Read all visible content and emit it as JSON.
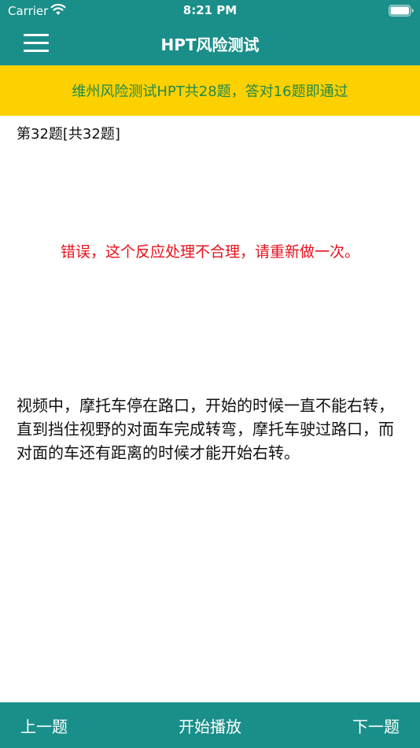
{
  "status_bar": {
    "carrier": "Carrier",
    "time": "8:21 PM"
  },
  "nav": {
    "title": "HPT风险测试"
  },
  "banner": {
    "text": "维州风险测试HPT共28题，答对16题即通过"
  },
  "question": {
    "counter": "第32题[共32题]",
    "result_message": "错误，这个反应处理不合理，请重新做一次。",
    "explanation": "视频中，摩托车停在路口，开始的时候一直不能右转，直到挡住视野的对面车完成转弯，摩托车驶过路口，而对面的车还有距离的时候才能开始右转。"
  },
  "bottom_bar": {
    "prev_label": "上一题",
    "play_label": "开始播放",
    "next_label": "下一题"
  },
  "colors": {
    "primary": "#1a8f8a",
    "banner_bg": "#fdd000",
    "banner_text": "#1f8a4c",
    "error_text": "#e8111b"
  },
  "icons": [
    "wifi-icon",
    "battery-icon",
    "menu-icon"
  ]
}
